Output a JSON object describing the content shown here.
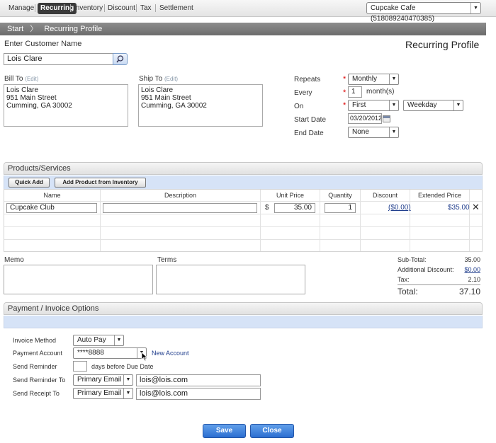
{
  "nav": {
    "items": [
      "Manage",
      "Recurring",
      "Inventory",
      "Discount",
      "Tax",
      "Settlement"
    ],
    "company_select": "Cupcake Cafe (518089240470385)"
  },
  "breadcrumb": {
    "start": "Start",
    "current": "Recurring Profile"
  },
  "customer": {
    "label": "Enter Customer Name",
    "value": "Lois Clare",
    "page_title": "Recurring Profile"
  },
  "bill_to": {
    "label": "Bill To",
    "edit": "(Edit)",
    "lines": [
      "Lois Clare",
      "951 Main Street",
      "Cumming, GA 30002"
    ]
  },
  "ship_to": {
    "label": "Ship To",
    "edit": "(Edit)",
    "lines": [
      "Lois Clare",
      "951 Main Street",
      "Cumming, GA 30002"
    ]
  },
  "schedule": {
    "repeats_label": "Repeats",
    "repeats_value": "Monthly",
    "every_label": "Every",
    "every_value": "1",
    "every_unit": "month(s)",
    "on_label": "On",
    "on_value": "First",
    "on_day": "Weekday",
    "start_label": "Start Date",
    "start_value": "03/20/2012",
    "end_label": "End Date",
    "end_value": "None"
  },
  "products": {
    "title": "Products/Services",
    "quick_add": "Quick Add",
    "add_inventory": "Add Product from Inventory",
    "columns": [
      "Name",
      "Description",
      "Unit Price",
      "Quantity",
      "Discount",
      "Extended Price"
    ],
    "rows": [
      {
        "name": "Cupcake Club",
        "description": "",
        "currency": "$",
        "unit_price": "35.00",
        "quantity": "1",
        "discount": "($0.00)",
        "extended": "$35.00"
      }
    ]
  },
  "memo": {
    "memo_label": "Memo",
    "terms_label": "Terms"
  },
  "totals": {
    "subtotal_label": "Sub-Total:",
    "subtotal": "35.00",
    "discount_label": "Additional Discount:",
    "discount": "$0.00",
    "tax_label": "Tax:",
    "tax": "2.10",
    "total_label": "Total:",
    "total": "37.10"
  },
  "payment": {
    "title": "Payment / Invoice Options",
    "invoice_method_label": "Invoice Method",
    "invoice_method": "Auto Pay",
    "account_label": "Payment Account",
    "account": "****8888",
    "new_account": "New Account",
    "reminder_label": "Send Reminder",
    "reminder_suffix": "days before Due Date",
    "reminder_to_label": "Send Reminder To",
    "reminder_to_type": "Primary Email",
    "reminder_to_email": "lois@lois.com",
    "receipt_to_label": "Send Receipt To",
    "receipt_to_type": "Primary Email",
    "receipt_to_email": "lois@lois.com"
  },
  "actions": {
    "save": "Save",
    "close": "Close"
  }
}
